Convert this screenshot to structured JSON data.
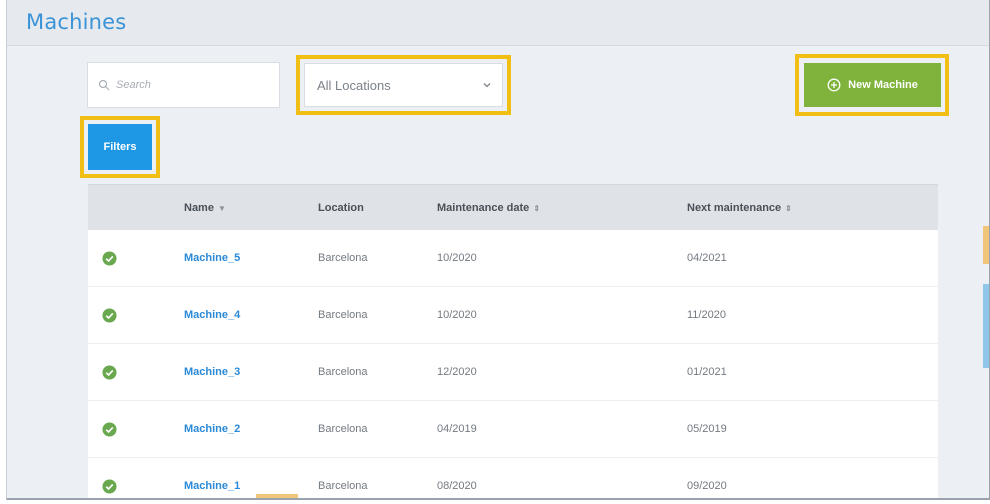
{
  "page": {
    "title": "Machines"
  },
  "toolbar": {
    "search_placeholder": "Search",
    "location_selected": "All Locations",
    "new_machine_label": "New Machine",
    "filters_label": "Filters"
  },
  "table": {
    "headers": {
      "name": "Name",
      "location": "Location",
      "maintenance_date": "Maintenance date",
      "next_maintenance": "Next maintenance"
    },
    "rows": [
      {
        "status": "ok",
        "name": "Machine_5",
        "location": "Barcelona",
        "maintenance_date": "10/2020",
        "next_maintenance": "04/2021"
      },
      {
        "status": "ok",
        "name": "Machine_4",
        "location": "Barcelona",
        "maintenance_date": "10/2020",
        "next_maintenance": "11/2020"
      },
      {
        "status": "ok",
        "name": "Machine_3",
        "location": "Barcelona",
        "maintenance_date": "12/2020",
        "next_maintenance": "01/2021"
      },
      {
        "status": "ok",
        "name": "Machine_2",
        "location": "Barcelona",
        "maintenance_date": "04/2019",
        "next_maintenance": "05/2019"
      },
      {
        "status": "ok",
        "name": "Machine_1",
        "location": "Barcelona",
        "maintenance_date": "08/2020",
        "next_maintenance": "09/2020"
      }
    ]
  },
  "colors": {
    "title": "#3a93d6",
    "new_button": "#7fb33b",
    "filters_button": "#1e97e5",
    "highlight": "#f1be13",
    "status_ok": "#6aa84f",
    "link": "#2a8ad8"
  },
  "icons": {
    "search": "search-icon",
    "dropdown": "chevron-down-icon",
    "new": "plus-circle-icon",
    "status": "check-circle-icon",
    "sort_active": "caret-down-icon",
    "sort_both": "sort-icon"
  }
}
